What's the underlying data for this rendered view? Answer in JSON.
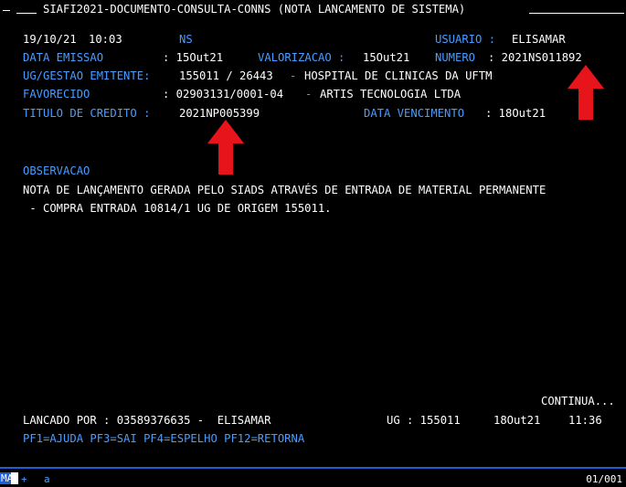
{
  "header": {
    "title": "SIAFI2021-DOCUMENTO-CONSULTA-CONNS (NOTA LANCAMENTO DE SISTEMA)",
    "date": "19/10/21",
    "time": "10:03",
    "doc_type": "NS",
    "user_label": "USUARIO :",
    "user_value": "ELISAMAR"
  },
  "fields": {
    "emissao_label": "DATA EMISSAO",
    "emissao_value": ": 15Out21",
    "valorizacao_label": "VALORIZACAO :",
    "valorizacao_value": "15Out21",
    "numero_label": "NUMERO",
    "numero_value": ": 2021NS011892",
    "ug_label": "UG/GESTAO EMITENTE:",
    "ug_value": "155011 / 26443",
    "ug_dash": "-",
    "ug_name": "HOSPITAL DE CLINICAS DA UFTM",
    "favorecido_label": "FAVORECIDO",
    "favorecido_value": ": 02903131/0001-04",
    "favorecido_dash": "-",
    "favorecido_name": "ARTIS TECNOLOGIA LTDA",
    "titulo_label": "TITULO DE CREDITO :",
    "titulo_value": "2021NP005399",
    "vencimento_label": "DATA VENCIMENTO",
    "vencimento_value": ": 18Out21"
  },
  "observacao": {
    "label": "OBSERVACAO",
    "line1": "NOTA DE LANÇAMENTO GERADA PELO SIADS ATRAVÉS DE ENTRADA DE MATERIAL PERMANENTE",
    "line2": " - COMPRA ENTRADA 10814/1 UG DE ORIGEM 155011."
  },
  "footer": {
    "continua": "CONTINUA...",
    "lancado": "LANCADO POR : 03589376635 -  ELISAMAR",
    "ug": "UG : 155011",
    "date": "18Out21",
    "time": "11:36",
    "pf_keys": "PF1=AJUDA PF3=SAI PF4=ESPELHO PF12=RETORNA"
  },
  "statusbar": {
    "ma": "MA",
    "plus": "+",
    "a": "a",
    "page": "01/001"
  },
  "colors": {
    "background": "#000000",
    "label_blue": "#4a9cff",
    "text_white": "#ffffff",
    "arrow_red": "#e8141c",
    "status_blue": "#1e5fd8"
  }
}
